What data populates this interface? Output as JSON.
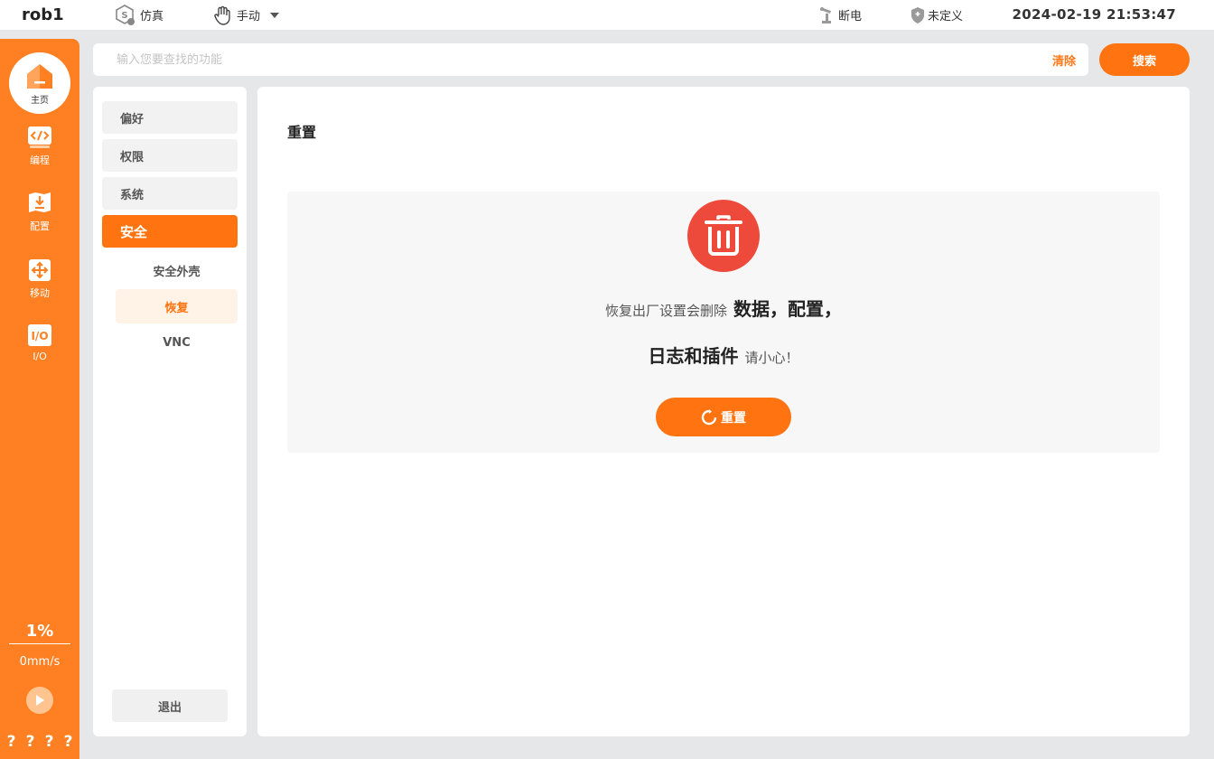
{
  "topbar": {
    "robot_name": "rob1",
    "mode": "仿真",
    "control": "手动",
    "power": "断电",
    "safety": "未定义",
    "datetime": "2024-02-19 21:53:47"
  },
  "rail": {
    "home": "主页",
    "items": [
      {
        "label": "编程",
        "icon": "code-icon"
      },
      {
        "label": "配置",
        "icon": "install-icon"
      },
      {
        "label": "移动",
        "icon": "move-icon"
      },
      {
        "label": "I/O",
        "icon": "io-icon"
      }
    ],
    "speed_percent": "1%",
    "speed_value": "0mm/s",
    "help_marks": [
      "?",
      "?",
      "?",
      "?"
    ]
  },
  "search": {
    "placeholder": "输入您要查找的功能",
    "value": "",
    "clear_label": "清除",
    "button_label": "搜索"
  },
  "nav": {
    "items": [
      {
        "label": "偏好"
      },
      {
        "label": "权限"
      },
      {
        "label": "系统"
      },
      {
        "label": "安全"
      }
    ],
    "active_index": 3,
    "sub_items": [
      {
        "label": "安全外壳"
      },
      {
        "label": "恢复"
      },
      {
        "label": "VNC"
      }
    ],
    "active_sub_index": 1,
    "logout_label": "退出"
  },
  "main": {
    "title": "重置",
    "message_part1": "恢复出厂设置会删除",
    "message_strong1": "数据，配置，",
    "message_strong2": "日志和插件",
    "message_part2": "请小心！",
    "reset_button": "重置"
  },
  "colors": {
    "accent": "#ff7410",
    "rail": "#ff8022",
    "danger": "#ee4a3b"
  }
}
